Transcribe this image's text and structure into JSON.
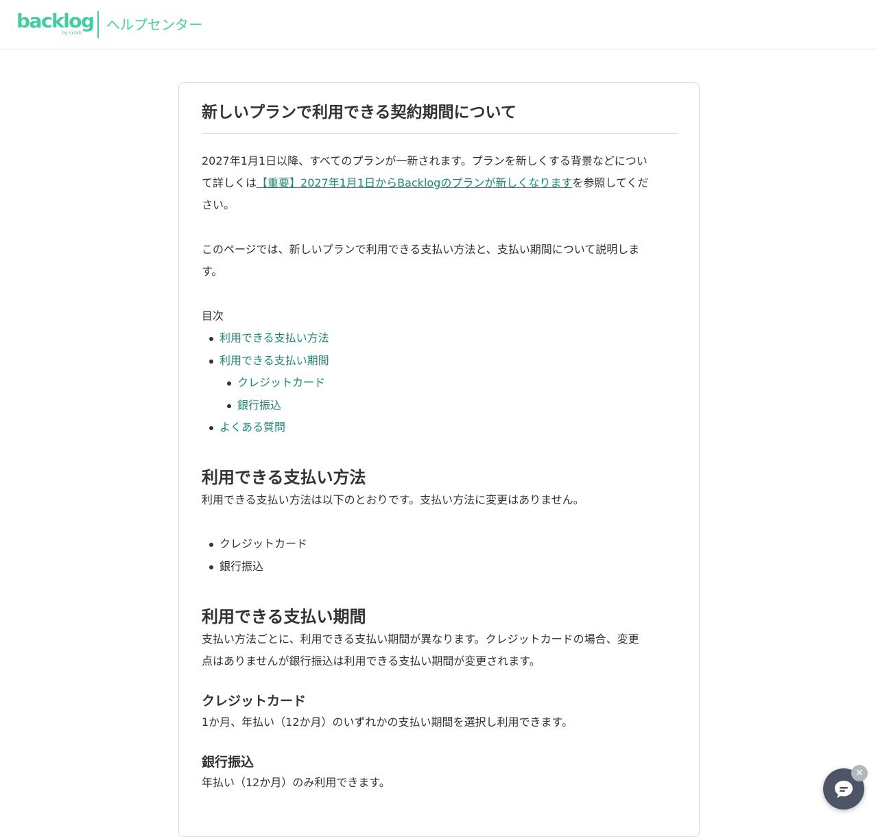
{
  "header": {
    "logo_text": "backlog",
    "logo_by": "by nulab",
    "title": "ヘルプセンター"
  },
  "article": {
    "title": "新しいプランで利用できる契約期間について",
    "intro": {
      "line1": "2027年1月1日以降、すべてのプランが一新されます。プランを新しくする背景などについ",
      "line2_pre": "て詳しくは",
      "link_text": "【重要】2027年1月1日からBacklogのプランが新しくなります",
      "line2_post": "を参照してくだ",
      "line3": "さい。"
    },
    "overview": {
      "line1": "このページでは、新しいプランで利用できる支払い方法と、支払い期間について説明しま",
      "line2": "す。"
    },
    "toc": {
      "label": "目次",
      "items": [
        "利用できる支払い方法",
        "利用できる支払い期間",
        "クレジットカード",
        "銀行振込",
        "よくある質問"
      ]
    },
    "section_methods": {
      "heading": "利用できる支払い方法",
      "text": "利用できる支払い方法は以下のとおりです。支払い方法に変更はありません。",
      "items": [
        "クレジットカード",
        "銀行振込"
      ]
    },
    "section_periods": {
      "heading": "利用できる支払い期間",
      "line1": "支払い方法ごとに、利用できる支払い期間が異なります。クレジットカードの場合、変更",
      "line2": "点はありませんが銀行振込は利用できる支払い期間が変更されます。"
    },
    "credit_card": {
      "heading": "クレジットカード",
      "text": "1か月、年払い（12か月）のいずれかの支払い期間を選択し利用できます。"
    },
    "bank_transfer": {
      "heading": "銀行振込",
      "text": "年払い（12か月）のみ利用できます。"
    }
  },
  "chat": {
    "close_glyph": "✕"
  },
  "colors": {
    "brand": "#42ce9f",
    "link": "#1b8a73",
    "text": "#333333",
    "border": "#dddddd",
    "chat_bg": "#4d5566"
  }
}
